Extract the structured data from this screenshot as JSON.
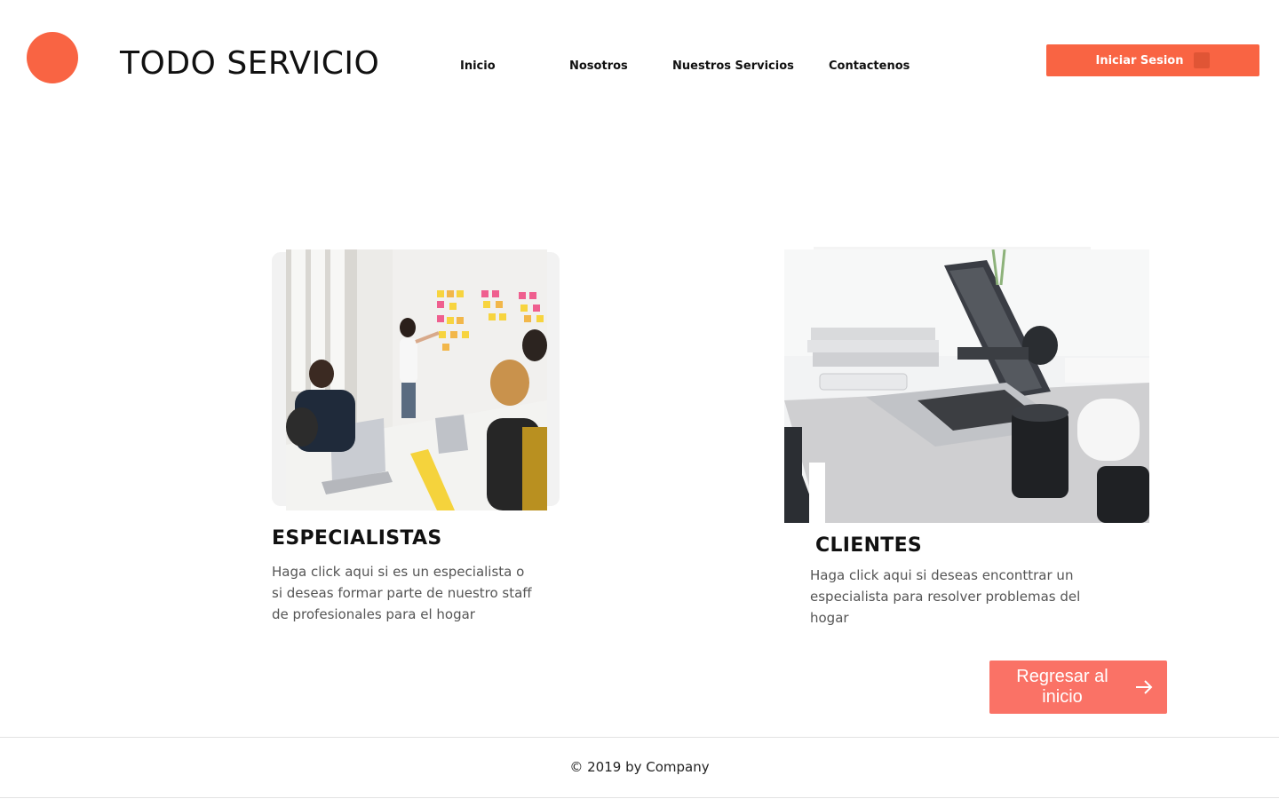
{
  "header": {
    "brand": "TODO SERVICIO",
    "nav": [
      {
        "label": "Inicio"
      },
      {
        "label": "Nosotros"
      },
      {
        "label": "Nuestros Servicios"
      },
      {
        "label": "Contactenos"
      }
    ],
    "login_label": "Iniciar Sesion"
  },
  "cards": [
    {
      "title": "ESPECIALISTAS",
      "description": "Haga click aqui si es un especialista o si deseas formar parte de nuestro staff de profesionales para el hogar"
    },
    {
      "title": "CLIENTES",
      "description": "Haga click aqui si deseas enconttrar un especialista para resolver problemas del hogar"
    }
  ],
  "back_button": {
    "label": "Regresar al inicio",
    "icon": "arrow-right-icon"
  },
  "footer": {
    "text": "© 2019 by Company"
  },
  "colors": {
    "brand": "#f96443",
    "back_button": "#fa7266"
  }
}
